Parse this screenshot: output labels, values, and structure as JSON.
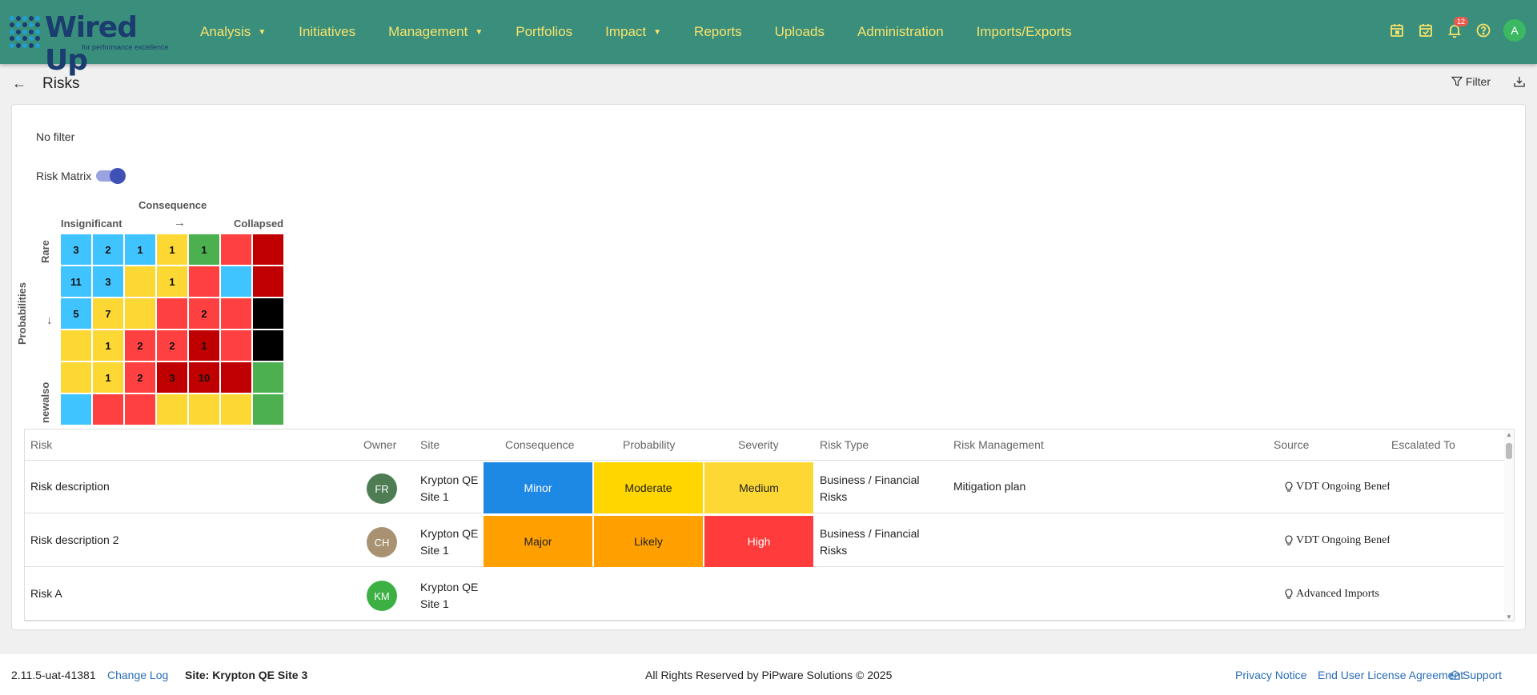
{
  "app": {
    "logo_text": "Wired Up",
    "logo_subtitle": "for performance excellence"
  },
  "nav": {
    "items": [
      {
        "label": "Analysis",
        "dropdown": true
      },
      {
        "label": "Initiatives",
        "dropdown": false
      },
      {
        "label": "Management",
        "dropdown": true
      },
      {
        "label": "Portfolios",
        "dropdown": false
      },
      {
        "label": "Impact",
        "dropdown": true
      },
      {
        "label": "Reports",
        "dropdown": false
      },
      {
        "label": "Uploads",
        "dropdown": false
      },
      {
        "label": "Administration",
        "dropdown": false
      },
      {
        "label": "Imports/Exports",
        "dropdown": false
      }
    ],
    "icons": [
      "calendar-icon",
      "calendar-check-icon",
      "bell-icon",
      "help-icon"
    ],
    "notification_count": "12",
    "user_initial": "A"
  },
  "page": {
    "title": "Risks",
    "filter_label": "Filter",
    "no_filter_text": "No filter",
    "risk_matrix_label": "Risk Matrix",
    "risk_matrix_enabled": true
  },
  "matrix": {
    "title": "Consequence",
    "x_left": "Insignificant",
    "x_arrow": "→",
    "x_right": "Collapsed",
    "y_title": "Probabilities",
    "y_top": "Rare",
    "y_arrow": "↓",
    "y_bottom": "newalso",
    "colors": {
      "blue": "#40c4ff",
      "yellow": "#fdd835",
      "red": "#ff4040",
      "darkred": "#c00000",
      "green": "#4caf50",
      "black": "#000000"
    },
    "rows": [
      [
        {
          "c": "blue",
          "v": "3"
        },
        {
          "c": "blue",
          "v": "2"
        },
        {
          "c": "blue",
          "v": "1"
        },
        {
          "c": "yellow",
          "v": "1"
        },
        {
          "c": "green",
          "v": "1"
        },
        {
          "c": "red",
          "v": ""
        },
        {
          "c": "darkred",
          "v": ""
        }
      ],
      [
        {
          "c": "blue",
          "v": "11"
        },
        {
          "c": "blue",
          "v": "3"
        },
        {
          "c": "yellow",
          "v": ""
        },
        {
          "c": "yellow",
          "v": "1"
        },
        {
          "c": "red",
          "v": ""
        },
        {
          "c": "blue",
          "v": ""
        },
        {
          "c": "darkred",
          "v": ""
        }
      ],
      [
        {
          "c": "blue",
          "v": "5"
        },
        {
          "c": "yellow",
          "v": "7"
        },
        {
          "c": "yellow",
          "v": ""
        },
        {
          "c": "red",
          "v": ""
        },
        {
          "c": "red",
          "v": "2"
        },
        {
          "c": "red",
          "v": ""
        },
        {
          "c": "black",
          "v": ""
        }
      ],
      [
        {
          "c": "yellow",
          "v": ""
        },
        {
          "c": "yellow",
          "v": "1"
        },
        {
          "c": "red",
          "v": "2"
        },
        {
          "c": "red",
          "v": "2"
        },
        {
          "c": "darkred",
          "v": "1"
        },
        {
          "c": "red",
          "v": ""
        },
        {
          "c": "black",
          "v": ""
        }
      ],
      [
        {
          "c": "yellow",
          "v": ""
        },
        {
          "c": "yellow",
          "v": "1"
        },
        {
          "c": "red",
          "v": "2"
        },
        {
          "c": "darkred",
          "v": "3"
        },
        {
          "c": "darkred",
          "v": "10"
        },
        {
          "c": "darkred",
          "v": ""
        },
        {
          "c": "green",
          "v": ""
        }
      ],
      [
        {
          "c": "blue",
          "v": ""
        },
        {
          "c": "red",
          "v": ""
        },
        {
          "c": "red",
          "v": ""
        },
        {
          "c": "yellow",
          "v": ""
        },
        {
          "c": "yellow",
          "v": ""
        },
        {
          "c": "yellow",
          "v": ""
        },
        {
          "c": "green",
          "v": ""
        }
      ]
    ]
  },
  "table": {
    "headers": {
      "risk": "Risk",
      "owner": "Owner",
      "site": "Site",
      "consequence": "Consequence",
      "probability": "Probability",
      "severity": "Severity",
      "risk_type": "Risk Type",
      "risk_management": "Risk Management",
      "source": "Source",
      "escalated_to": "Escalated To"
    },
    "rows": [
      {
        "risk": "Risk description",
        "owner": "FR",
        "owner_color": "#4e7d54",
        "site_line1": "Krypton QE",
        "site_line2": "Site 1",
        "consequence": "Minor",
        "consequence_color": "#1e88e5",
        "consequence_text": "#ffffff",
        "probability": "Moderate",
        "probability_color": "#ffd600",
        "probability_text": "#222222",
        "severity": "Medium",
        "severity_color": "#fdd835",
        "severity_text": "#222222",
        "risk_type_line1": "Business / Financial",
        "risk_type_line2": "Risks",
        "risk_management": "Mitigation plan",
        "source": "VDT Ongoing Benefit",
        "escalated_to": ""
      },
      {
        "risk": "Risk description 2",
        "owner": "CH",
        "owner_color": "#a89272",
        "site_line1": "Krypton QE",
        "site_line2": "Site 1",
        "consequence": "Major",
        "consequence_color": "#ff9f00",
        "consequence_text": "#222222",
        "probability": "Likely",
        "probability_color": "#ff9f00",
        "probability_text": "#222222",
        "severity": "High",
        "severity_color": "#ff3b3b",
        "severity_text": "#ffffff",
        "risk_type_line1": "Business / Financial",
        "risk_type_line2": "Risks",
        "risk_management": "",
        "source": "VDT Ongoing Benefit",
        "escalated_to": ""
      },
      {
        "risk": "Risk A",
        "owner": "KM",
        "owner_color": "#3cb043",
        "site_line1": "Krypton QE",
        "site_line2": "Site 1",
        "consequence": "",
        "consequence_color": "",
        "consequence_text": "",
        "probability": "",
        "probability_color": "",
        "probability_text": "",
        "severity": "",
        "severity_color": "",
        "severity_text": "",
        "risk_type_line1": "",
        "risk_type_line2": "",
        "risk_management": "",
        "source": "Advanced Imports",
        "escalated_to": ""
      }
    ]
  },
  "footer": {
    "version": "2.11.5-uat-41381",
    "change_log": "Change Log",
    "site": "Site: Krypton QE Site 3",
    "rights": "All Rights Reserved by PiPware Solutions © 2025",
    "privacy": "Privacy Notice",
    "eula": "End User License Agreement",
    "support": "Support"
  }
}
